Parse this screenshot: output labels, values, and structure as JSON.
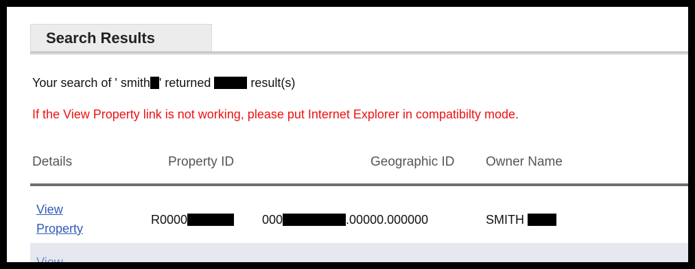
{
  "tab": {
    "title": "Search Results"
  },
  "summary": {
    "prefix": "Your search of ' smith",
    "middle": "' returned ",
    "suffix": " result(s)"
  },
  "warning": "If the View Property link is not working, please put Internet Explorer in compatibilty mode.",
  "table": {
    "headers": [
      "Details",
      "Property ID",
      "Geographic ID",
      "Owner Name"
    ],
    "rows": [
      {
        "details_link": "View Property",
        "property_id": "R0000",
        "geographic_id_prefix": "000",
        "geographic_id_suffix": ".00000.000000",
        "owner_name": "SMITH"
      },
      {
        "details_link": "View"
      }
    ]
  }
}
